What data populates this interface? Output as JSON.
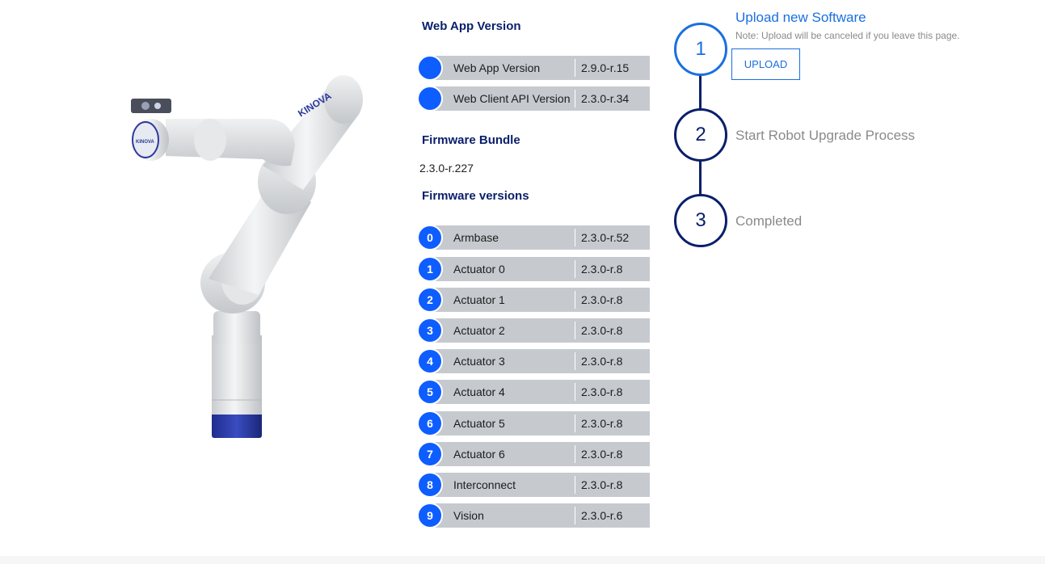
{
  "web_app": {
    "title": "Web App Version",
    "rows": [
      {
        "name": "Web App Version",
        "version": "2.9.0-r.15"
      },
      {
        "name": "Web Client API Version",
        "version": "2.3.0-r.34"
      }
    ]
  },
  "firmware_bundle": {
    "title": "Firmware Bundle",
    "value": "2.3.0-r.227"
  },
  "firmware_versions": {
    "title": "Firmware versions",
    "rows": [
      {
        "index": "0",
        "name": "Armbase",
        "version": "2.3.0-r.52"
      },
      {
        "index": "1",
        "name": "Actuator 0",
        "version": "2.3.0-r.8"
      },
      {
        "index": "2",
        "name": "Actuator 1",
        "version": "2.3.0-r.8"
      },
      {
        "index": "3",
        "name": "Actuator 2",
        "version": "2.3.0-r.8"
      },
      {
        "index": "4",
        "name": "Actuator 3",
        "version": "2.3.0-r.8"
      },
      {
        "index": "5",
        "name": "Actuator 4",
        "version": "2.3.0-r.8"
      },
      {
        "index": "6",
        "name": "Actuator 5",
        "version": "2.3.0-r.8"
      },
      {
        "index": "7",
        "name": "Actuator 6",
        "version": "2.3.0-r.8"
      },
      {
        "index": "8",
        "name": "Interconnect",
        "version": "2.3.0-r.8"
      },
      {
        "index": "9",
        "name": "Vision",
        "version": "2.3.0-r.6"
      }
    ]
  },
  "robot": {
    "brand_label": "KINOVA",
    "image_icon": "robot-arm-illustration"
  },
  "stepper": {
    "steps": [
      {
        "number": "1",
        "title": "Upload new Software",
        "note": "Note: Upload will be canceled if you leave this page.",
        "button_label": "UPLOAD"
      },
      {
        "number": "2",
        "title": "Start Robot Upgrade Process"
      },
      {
        "number": "3",
        "title": "Completed"
      }
    ]
  },
  "colors": {
    "accent": "#1a6fe0",
    "navy": "#0a1f6b",
    "badge": "#0e5dff",
    "row_bar": "#c6cacf"
  }
}
